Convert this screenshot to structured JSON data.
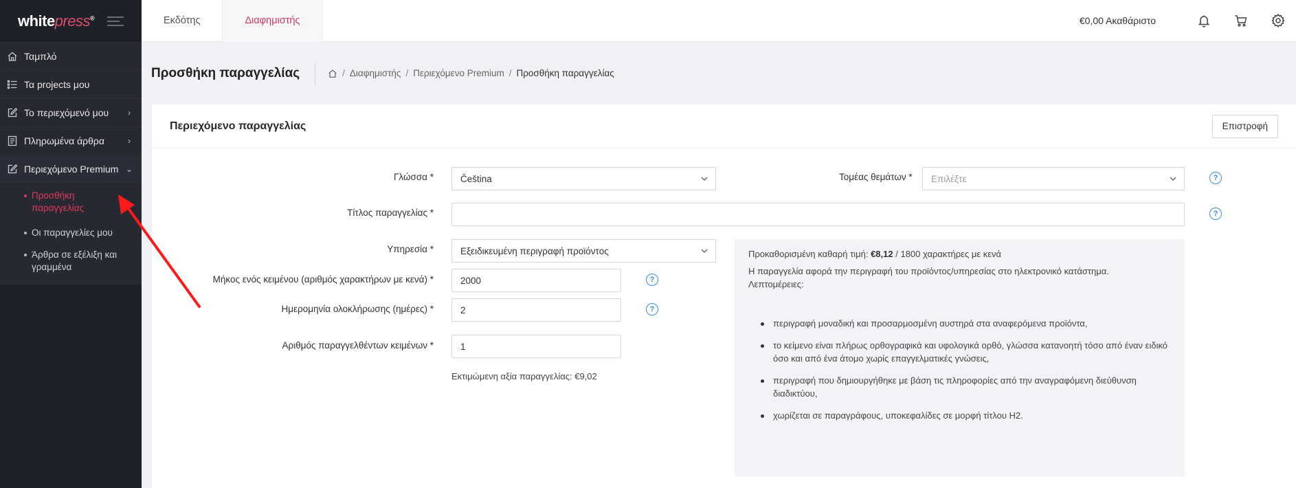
{
  "logo": {
    "main": "white",
    "accent": "press",
    "mark": "®"
  },
  "sidebar": {
    "items": [
      {
        "label": "Ταμπλό",
        "icon": "home-icon"
      },
      {
        "label": "Τα projects μου",
        "icon": "list-icon"
      },
      {
        "label": "Το περιεχόμενό μου",
        "icon": "edit-icon"
      },
      {
        "label": "Πληρωμένα άρθρα",
        "icon": "document-icon"
      },
      {
        "label": "Περιεχόμενο Premium",
        "icon": "edit-icon"
      }
    ],
    "submenu": [
      {
        "label": "Προσθήκη παραγγελίας"
      },
      {
        "label": "Οι παραγγελίες μου"
      },
      {
        "label": "Άρθρα σε εξέλιξη και γραμμένα"
      }
    ]
  },
  "topbar": {
    "tabs": [
      {
        "label": "Εκδότης"
      },
      {
        "label": "Διαφημιστής"
      }
    ],
    "balance": "€0,00 Ακαθάριστο"
  },
  "page": {
    "title": "Προσθήκη παραγγελίας",
    "breadcrumb": [
      "Διαφημιστής",
      "Περιεχόμενο Premium",
      "Προσθήκη παραγγελίας"
    ]
  },
  "card": {
    "title": "Περιεχόμενο παραγγελίας",
    "back_label": "Επιστροφή"
  },
  "form": {
    "language": {
      "label": "Γλώσσα *",
      "value": "Čeština"
    },
    "category": {
      "label": "Τομέας θεμάτων *",
      "placeholder": "Επιλέξτε"
    },
    "title": {
      "label": "Τίτλος παραγγελίας *",
      "value": ""
    },
    "service": {
      "label": "Υπηρεσία *",
      "value": "Εξειδικευμένη περιγραφή προϊόντος"
    },
    "length": {
      "label": "Μήκος ενός κειμένου (αριθμός χαρακτήρων με κενά) *",
      "value": "2000"
    },
    "days": {
      "label": "Ημερομηνία ολοκλήρωσης (ημέρες) *",
      "value": "2"
    },
    "count": {
      "label": "Αριθμός παραγγελθέντων κειμένων *",
      "value": "1"
    },
    "estimate": "Εκτιμώμενη αξία παραγγελίας: €9,02"
  },
  "info": {
    "price_prefix": "Προκαθορισμένη καθαρή τιμή: ",
    "price": "€8,12",
    "price_suffix": " / 1800 χαρακτήρες με κενά",
    "description": "Η παραγγελία αφορά την περιγραφή του προϊόντος/υπηρεσίας στο ηλεκτρονικό κατάστημα.",
    "details_label": "Λεπτομέρειες:",
    "bullets": [
      "περιγραφή μοναδική και προσαρμοσμένη αυστηρά στα αναφερόμενα προϊόντα,",
      "το κείμενο είναι πλήρως ορθογραφικά και υφολογικά ορθό, γλώσσα κατανοητή τόσο από έναν ειδικό όσο και από ένα άτομο χωρίς επαγγελματικές γνώσεις,",
      "περιγραφή που δημιουργήθηκε με βάση τις πληροφορίες από την αναγραφόμενη διεύθυνση διαδικτύου,",
      "χωρίζεται σε παραγράφους, υποκεφαλίδες σε μορφή τίτλου H2."
    ]
  },
  "colors": {
    "accent": "#d9365b",
    "sidebar_bg": "#1f2129",
    "help_blue": "#3a8ee0",
    "annotation_red": "#ff1a1a"
  }
}
